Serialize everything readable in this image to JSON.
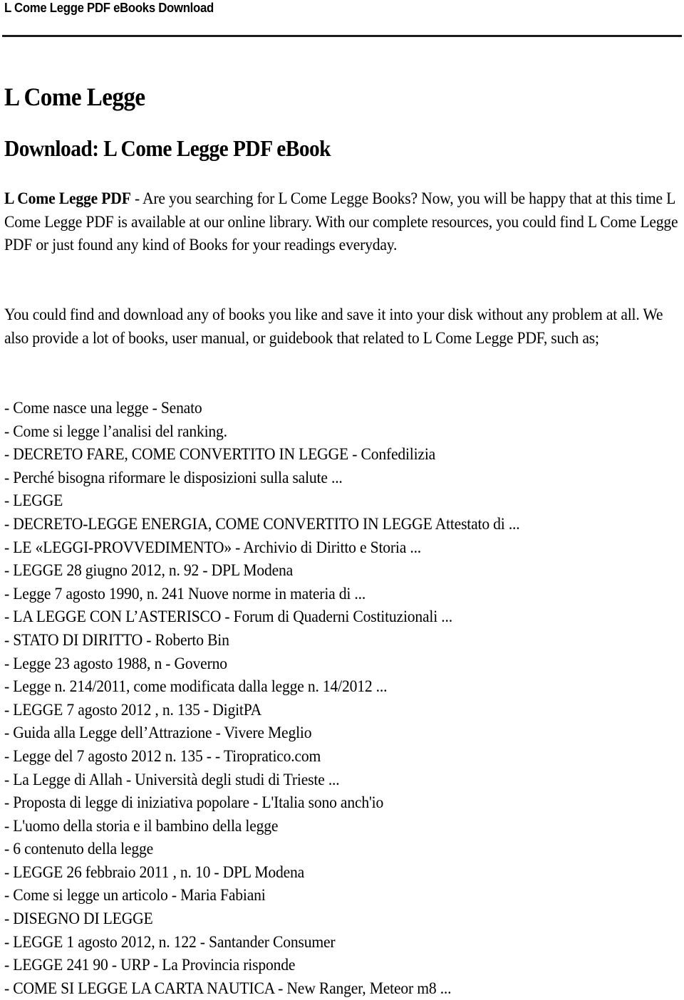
{
  "header": {
    "title": "L Come Legge PDF eBooks Download"
  },
  "document": {
    "title": "L Come Legge",
    "subtitle": "Download: L Come Legge PDF eBook",
    "intro": {
      "lead_bold": "L Come Legge PDF",
      "text": " - Are you searching for L Come Legge Books? Now, you will be happy that at this time L Come Legge PDF is available at our online library. With our complete resources, you could find L Come Legge PDF or just found any kind of Books for your readings everyday."
    },
    "paragraph2": "You could find and download any of books you like and save it into your disk without any problem at all. We also provide a lot of books, user manual, or guidebook that related to L Come Legge PDF, such as;",
    "related_items": [
      "- Come nasce una legge - Senato",
      "- Come si legge l’analisi del ranking.",
      "- DECRETO FARE, COME CONVERTITO IN LEGGE - Confedilizia",
      "- Perché bisogna riformare le disposizioni sulla salute ...",
      "- LEGGE",
      "- DECRETO-LEGGE ENERGIA, COME CONVERTITO IN LEGGE Attestato di ...",
      "- LE «LEGGI-PROVVEDIMENTO» - Archivio di Diritto e Storia ...",
      "- LEGGE 28 giugno 2012, n. 92 - DPL Modena",
      "- Legge 7 agosto 1990, n. 241 Nuove norme in materia di ...",
      "- LA LEGGE CON L’ASTERISCO - Forum di Quaderni Costituzionali ...",
      "- STATO DI DIRITTO - Roberto Bin",
      "- Legge 23 agosto 1988, n - Governo",
      "- Legge n. 214/2011, come modificata dalla legge n. 14/2012 ...",
      "- LEGGE 7 agosto 2012 , n. 135 - DigitPA",
      "- Guida alla Legge dell’Attrazione - Vivere Meglio",
      "- Legge del 7 agosto 2012 n. 135 - - Tiropratico.com",
      "- La Legge di Allah - Università degli studi di Trieste ...",
      "- Proposta di legge di iniziativa popolare - L'Italia sono anch'io",
      "- L'uomo della storia e il bambino della legge",
      "- 6 contenuto della legge",
      "- LEGGE 26 febbraio 2011 , n. 10 - DPL Modena",
      "- Come si legge un articolo - Maria Fabiani",
      "- DISEGNO DI LEGGE",
      "- LEGGE 1 agosto 2012, n. 122 - Santander Consumer",
      "- LEGGE 241 90 - URP - La Provincia risponde",
      "- COME SI LEGGE LA CARTA NAUTICA - New Ranger, Meteor m8 ..."
    ]
  }
}
